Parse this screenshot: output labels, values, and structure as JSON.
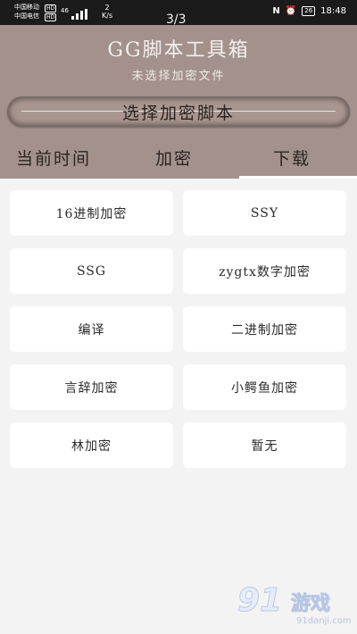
{
  "status_bar": {
    "carrier1": "中国移动",
    "carrier2": "中国电信",
    "hd": "HD",
    "network": "46",
    "speed_value": "2",
    "speed_unit": "K/s",
    "page_indicator": "3/3",
    "nfc": "N",
    "alarm": "⏰",
    "battery": "26",
    "time": "18:48"
  },
  "header": {
    "title": "GG脚本工具箱",
    "subtitle": "未选择加密文件",
    "select_button": "选择加密脚本",
    "tabs": [
      "当前时间",
      "加密",
      "下载"
    ]
  },
  "grid": {
    "items": [
      "16进制加密",
      "SSY",
      "SSG",
      "zygtx数字加密",
      "编译",
      "二进制加密",
      "言辞加密",
      "小鳄鱼加密",
      "林加密",
      "暂无"
    ]
  },
  "watermark": {
    "logo": "91",
    "text": "游戏",
    "url": "91danji.com"
  },
  "colors": {
    "header_bg": "#a3928c",
    "page_bg": "#f4f3f3",
    "status_bg": "#1b1b1b"
  }
}
